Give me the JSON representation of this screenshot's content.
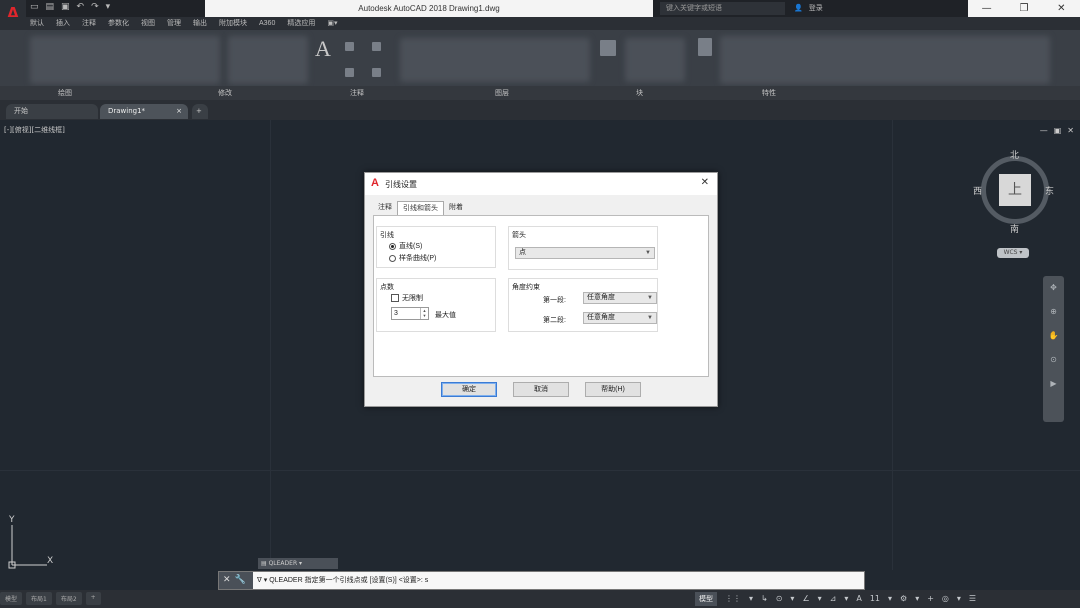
{
  "app": {
    "logo": "A",
    "title": "Autodesk AutoCAD 2018   Drawing1.dwg",
    "search_placeholder": "键入关键字或短语",
    "sign_in": "登录",
    "window_controls": [
      "—",
      "❐",
      "✕"
    ]
  },
  "quick_access": [
    "▭",
    "▤",
    "▣",
    "↶",
    "↷",
    "▾"
  ],
  "menu_tabs": [
    "默认",
    "插入",
    "注释",
    "参数化",
    "视图",
    "管理",
    "输出",
    "附加模块",
    "A360",
    "精选应用",
    "▣▾"
  ],
  "ribbon": {
    "panels": [
      "绘图",
      "修改",
      "注释",
      "图层",
      "块",
      "特性"
    ],
    "big_glyph": "A"
  },
  "doc_tabs": [
    {
      "label": "开始",
      "active": false
    },
    {
      "label": "Drawing1*",
      "active": true,
      "close": "×"
    },
    {
      "label": "+",
      "active": false
    }
  ],
  "viewport": {
    "label": "[-][俯视][二维线框]",
    "controls": [
      "—",
      "▣",
      "✕"
    ]
  },
  "viewcube": {
    "face": "上",
    "north": "北",
    "south": "南",
    "east": "东",
    "west": "西",
    "wcs": "WCS ▾"
  },
  "navbar": [
    "✥",
    "⊕",
    "✋",
    "⊙",
    "▶"
  ],
  "ucs": {
    "x": "X",
    "y": "Y"
  },
  "command_tooltip": "▤ QLEADER ▾",
  "command_line": {
    "buttons": [
      "✕",
      "🔧"
    ],
    "text": "ᐁ ▾ QLEADER 指定第一个引线点或 [设置(S)] <设置>: s"
  },
  "layout_tabs": [
    "模型",
    "布局1",
    "布局2",
    "+"
  ],
  "status_bar": {
    "model": "模型",
    "items": [
      "⋮⋮",
      "▾",
      "↳",
      "⊙",
      "▾",
      "∠",
      "▾",
      "⊿",
      "▾",
      "A",
      "11",
      "▾",
      "⚙",
      "▾",
      "+",
      "◎",
      "▾",
      "☰"
    ]
  },
  "dialog": {
    "logo": "A",
    "title": "引线设置",
    "close": "✕",
    "tabs": [
      {
        "label": "注释",
        "active": false
      },
      {
        "label": "引线和箭头",
        "active": true
      },
      {
        "label": "附着",
        "active": false
      }
    ],
    "leader": {
      "title": "引线",
      "options": [
        {
          "label": "直线(S)",
          "checked": true
        },
        {
          "label": "样条曲线(P)",
          "checked": false
        }
      ]
    },
    "points": {
      "title": "点数",
      "no_limit_label": "无限制",
      "value": "3",
      "max_label": "最大值"
    },
    "arrow": {
      "title": "箭头",
      "value": "点"
    },
    "angle": {
      "title": "角度约束",
      "first_label": "第一段:",
      "first_value": "任意角度",
      "second_label": "第二段:",
      "second_value": "任意角度"
    },
    "buttons": {
      "ok": "确定",
      "cancel": "取消",
      "help": "帮助(H)"
    }
  }
}
